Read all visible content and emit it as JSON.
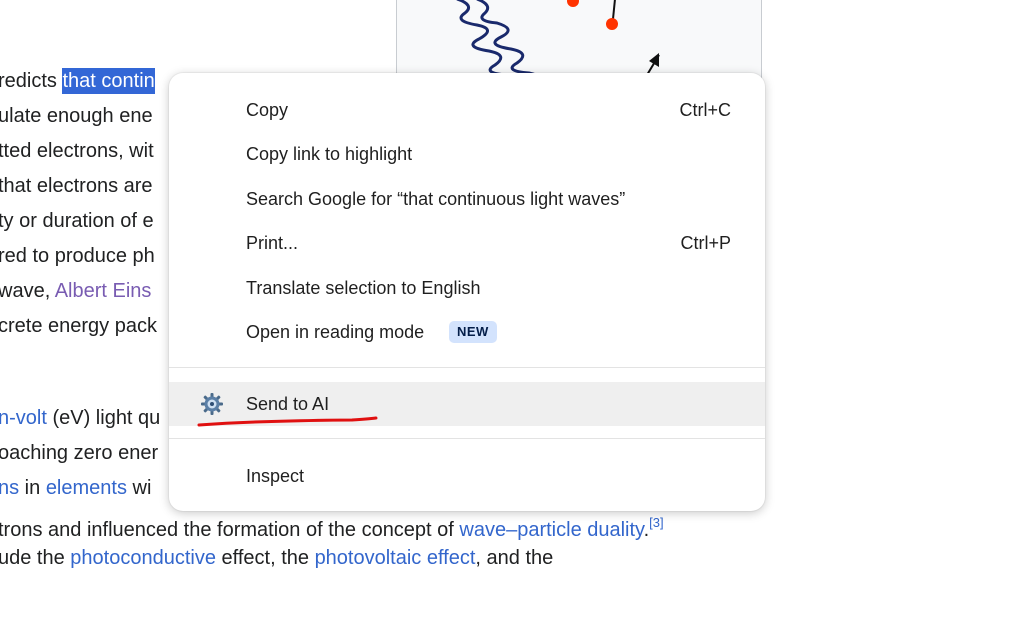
{
  "article": {
    "lines": [
      {
        "pre": "redicts ",
        "selected": "that contin",
        "tail": ""
      },
      {
        "text": "ulate enough ene"
      },
      {
        "text": "tted electrons, wit"
      },
      {
        "text": " that electrons are"
      },
      {
        "text": "ty or duration of e"
      },
      {
        "text": "red to produce ph"
      },
      {
        "pre": " wave, ",
        "link": "Albert Eins"
      },
      {
        "text": "crete energy pack"
      },
      {
        "link1": "n-volt",
        "mid": " (eV) light qu"
      },
      {
        "text": "oaching zero ener"
      },
      {
        "link1": "ns",
        "mid": " in ",
        "link2": "elements",
        "post": " wi"
      },
      {
        "pre": "trons and influenced the formation of the concept of ",
        "link": "wave–particle duality",
        "post": ".",
        "ref": "[3]"
      },
      {
        "pre": "ude the ",
        "link1": "photoconductive",
        "mid": " effect, the ",
        "link2": "photovoltaic effect",
        "post": ", and the"
      }
    ]
  },
  "context_menu": {
    "items": [
      {
        "label": "Copy",
        "shortcut": "Ctrl+C"
      },
      {
        "label": "Copy link to highlight"
      },
      {
        "label": "Search Google for “that continuous light waves”"
      },
      {
        "label": "Print...",
        "shortcut": "Ctrl+P"
      },
      {
        "label": "Translate selection to English"
      },
      {
        "label": "Open in reading mode",
        "badge": "NEW"
      },
      {
        "label": "Send to AI",
        "icon": "extension-gear-icon"
      },
      {
        "label": "Inspect"
      }
    ]
  },
  "colors": {
    "selection": "#3367d6",
    "link": "#3366cc",
    "visited_link": "#795cb2",
    "badge_bg": "#d3e3fd",
    "annotation_red": "#e01010"
  }
}
